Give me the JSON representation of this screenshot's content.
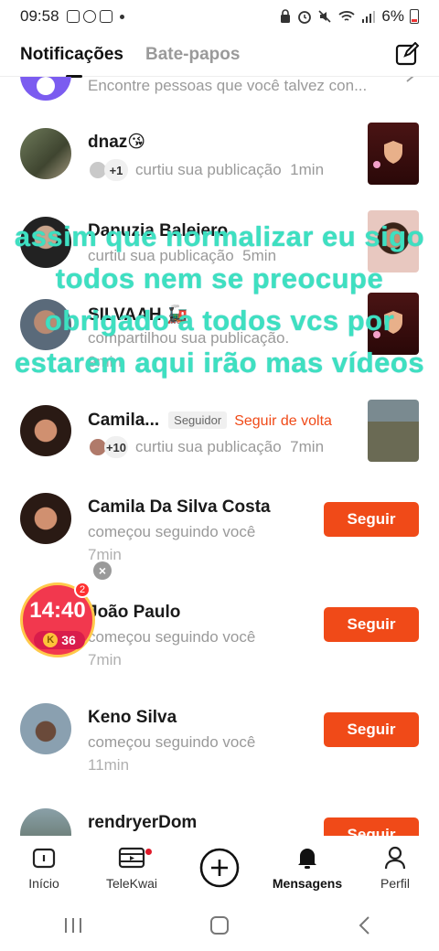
{
  "status": {
    "time": "09:58",
    "battery": "6%"
  },
  "header": {
    "tabs": [
      {
        "label": "Notificações",
        "active": true
      },
      {
        "label": "Bate-papos",
        "active": false
      }
    ],
    "compose_icon": "compose-icon"
  },
  "notifications": [
    {
      "type": "suggestion",
      "text": "Encontre pessoas que você talvez con..."
    },
    {
      "type": "like",
      "name": "dnaz😘",
      "extra_count": "+1",
      "action": "curtiu sua publicação",
      "time": "1min"
    },
    {
      "type": "like",
      "name": "Danuzia Baleiero",
      "action": "curtiu sua publicação",
      "time": "5min"
    },
    {
      "type": "share",
      "name": "SILVAAH 🚂",
      "action": "compartilhou sua publicação.",
      "time": "9min"
    },
    {
      "type": "like",
      "name": "Camila...",
      "tag": "Seguidor",
      "follow_back": "Seguir de volta",
      "extra_count": "+10",
      "action": "curtiu sua publicação",
      "time": "7min"
    },
    {
      "type": "follow",
      "name": "Camila Da Silva Costa",
      "action": "começou seguindo você",
      "time": "7min",
      "button": "Seguir"
    },
    {
      "type": "follow",
      "name": "João Paulo",
      "action": "começou seguindo você",
      "time": "7min",
      "button": "Seguir"
    },
    {
      "type": "follow",
      "name": "Keno Silva",
      "action": "começou seguindo você",
      "time": "11min",
      "button": "Seguir"
    },
    {
      "type": "follow",
      "name": "rendryerDom",
      "button": "Seguir"
    }
  ],
  "overlay_caption": "assim que normalizar eu sigo todos nem se preocupe obrigado a todos vcs por estarem aqui irão mas vídeos",
  "timer_widget": {
    "time": "14:40",
    "coin_letter": "K",
    "coins": "36",
    "badge": "2",
    "close": "×"
  },
  "bottom_nav": [
    {
      "label": "Início",
      "icon": "home-icon"
    },
    {
      "label": "TeleKwai",
      "icon": "tv-icon",
      "dot": true
    },
    {
      "label": "",
      "icon": "plus-circle-icon"
    },
    {
      "label": "Mensagens",
      "icon": "bell-icon",
      "active": true
    },
    {
      "label": "Perfil",
      "icon": "person-icon"
    }
  ],
  "colors": {
    "accent": "#f04a18",
    "overlay": "#3ee0c0",
    "muted": "#9a9a9a"
  }
}
